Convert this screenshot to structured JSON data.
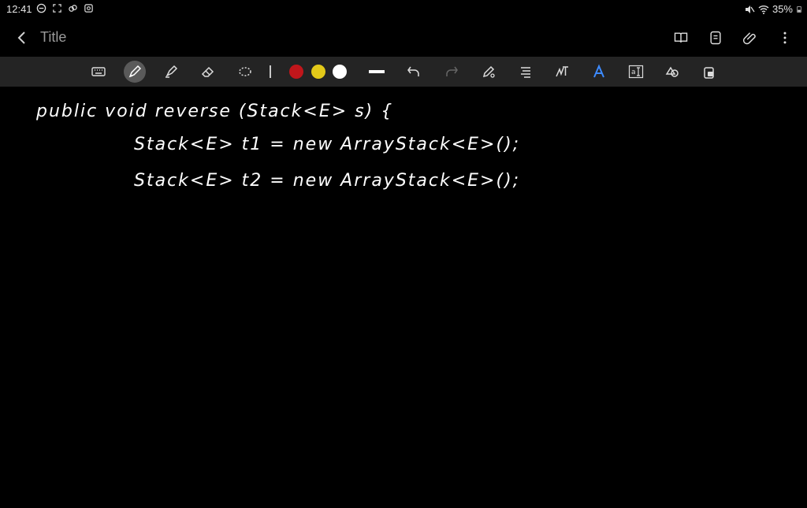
{
  "status_bar": {
    "time": "12:41",
    "battery": "35%",
    "left_icons": [
      "do-not-disturb-icon",
      "screen-capture-icon",
      "link-icon",
      "cast-icon"
    ],
    "right_icons": [
      "mute-icon",
      "wifi-icon",
      "battery-icon"
    ]
  },
  "app_bar": {
    "title": "Title",
    "actions": [
      "book-icon",
      "page-icon",
      "attach-icon",
      "more-icon"
    ]
  },
  "toolbar": {
    "tools": [
      "keyboard-icon",
      "pen-icon",
      "highlighter-icon",
      "eraser-icon",
      "lasso-icon",
      "line-width-icon",
      "undo-icon",
      "redo-icon",
      "pen-settings-icon",
      "text-format-icon",
      "handwriting-icon",
      "text-style-icon",
      "text-box-icon",
      "shapes-icon",
      "lock-icon"
    ],
    "active_tool": "pen-icon",
    "colors": [
      "#c0161b",
      "#e3c919",
      "#ffffff"
    ]
  },
  "note": {
    "lines": [
      "public void reverse (Stack<E> s) {",
      "Stack<E> t1 = new ArrayStack<E>();",
      "Stack<E> t2 = new ArrayStack<E>();"
    ]
  }
}
